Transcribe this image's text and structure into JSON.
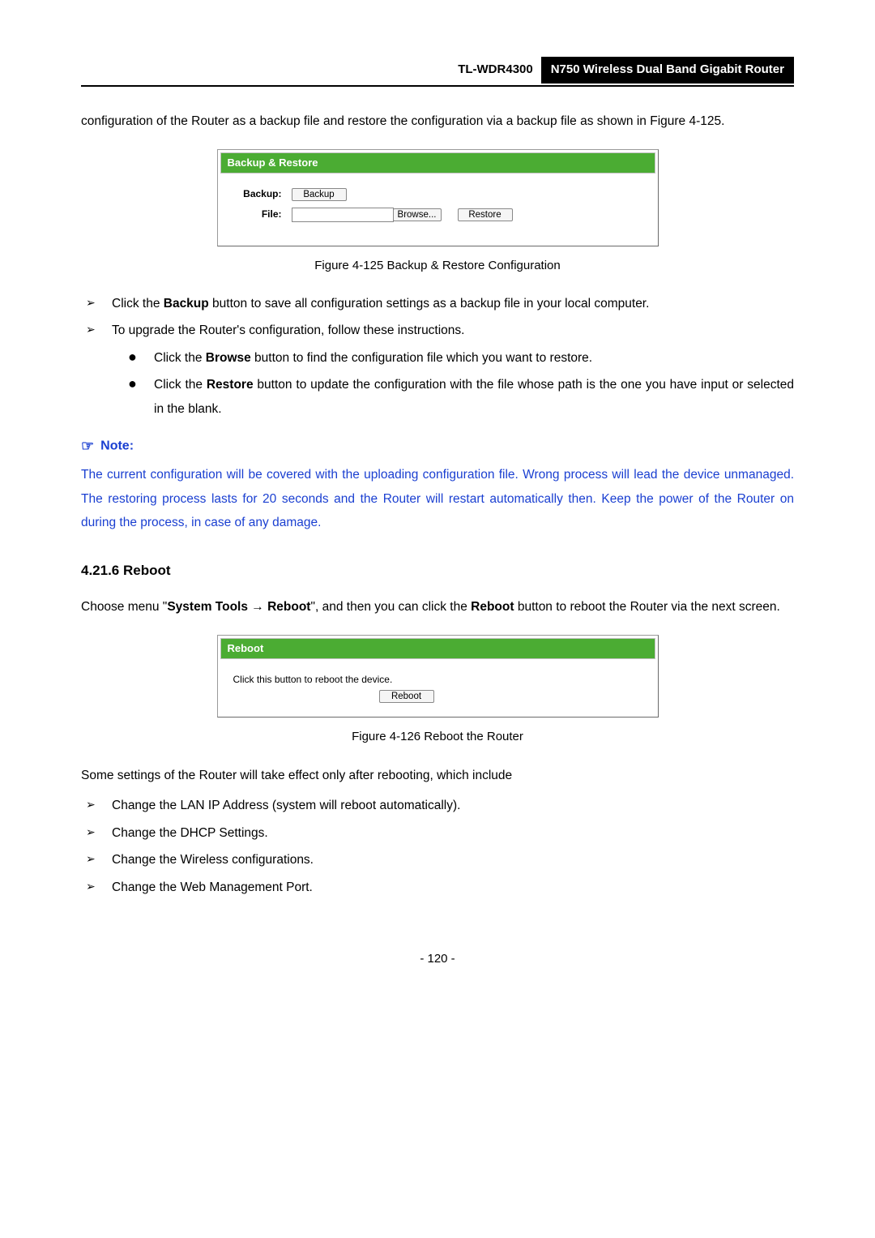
{
  "header": {
    "model": "TL-WDR4300",
    "title": "N750 Wireless Dual Band Gigabit Router"
  },
  "intro_para": "configuration of the Router as a backup file and restore the configuration via a backup file as shown in Figure 4-125.",
  "fig125": {
    "panel_title": "Backup & Restore",
    "backup_label": "Backup:",
    "file_label": "File:",
    "backup_btn": "Backup",
    "browse_btn": "Browse...",
    "restore_btn": "Restore",
    "caption": "Figure 4-125 Backup & Restore Configuration"
  },
  "instructions": {
    "arrow1_pre": "Click the ",
    "arrow1_bold": "Backup",
    "arrow1_post": " button to save all configuration settings as a backup file in your local computer.",
    "arrow2": "To upgrade the Router's configuration, follow these instructions.",
    "bullet1_pre": "Click the ",
    "bullet1_bold": "Browse",
    "bullet1_post": " button to find the configuration file which you want to restore.",
    "bullet2_pre": "Click the ",
    "bullet2_bold": "Restore",
    "bullet2_post": " button to update the configuration with the file whose path is the one you have input or selected in the blank."
  },
  "note": {
    "heading": "Note:",
    "body": "The current configuration will be covered with the uploading configuration file. Wrong process will lead the device unmanaged. The restoring process lasts for 20 seconds and the Router will restart automatically then. Keep the power of the Router on during the process, in case of any damage."
  },
  "section_reboot": {
    "heading": "4.21.6  Reboot",
    "para_pre": "Choose menu \"",
    "para_b1": "System Tools",
    "para_arrow": " → ",
    "para_b2": "Reboot",
    "para_mid": "\", and then you can click the ",
    "para_b3": "Reboot",
    "para_post": " button to reboot the Router via the next screen."
  },
  "fig126": {
    "panel_title": "Reboot",
    "hint": "Click this button to reboot the device.",
    "btn": "Reboot",
    "caption": "Figure 4-126 Reboot the Router"
  },
  "reboot_list": {
    "intro": "Some settings of the Router will take effect only after rebooting, which include",
    "item1": "Change the LAN IP Address (system will reboot automatically).",
    "item2": "Change the DHCP Settings.",
    "item3": "Change the Wireless configurations.",
    "item4": "Change the Web Management Port."
  },
  "page_number": "- 120 -"
}
